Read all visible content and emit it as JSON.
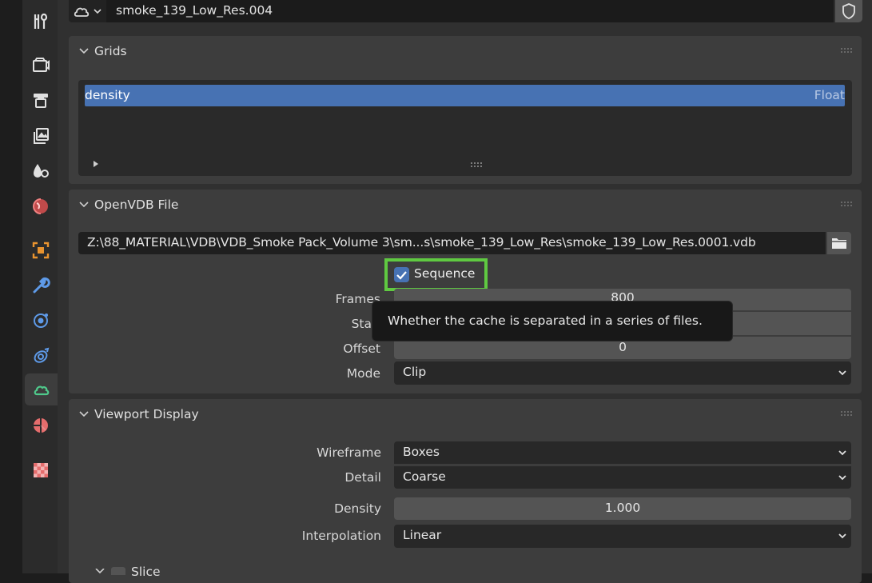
{
  "header": {
    "datablock_name": "smoke_139_Low_Res.004"
  },
  "grids": {
    "title": "Grids",
    "items": [
      {
        "name": "density",
        "type": "Float"
      }
    ]
  },
  "openvdb": {
    "title": "OpenVDB File",
    "filepath": "Z:\\88_MATERIAL\\VDB\\VDB_Smoke Pack_Volume 3\\sm...s\\smoke_139_Low_Res\\smoke_139_Low_Res.0001.vdb",
    "sequence_label": "Sequence",
    "sequence_checked": true,
    "frames_label": "Frames",
    "frames_value": "800",
    "start_label": "Sta",
    "offset_label": "Offset",
    "offset_value": "0",
    "mode_label": "Mode",
    "mode_value": "Clip",
    "tooltip": "Whether the cache is separated in a series of files."
  },
  "viewport": {
    "title": "Viewport Display",
    "wireframe_label": "Wireframe",
    "wireframe_value": "Boxes",
    "detail_label": "Detail",
    "detail_value": "Coarse",
    "density_label": "Density",
    "density_value": "1.000",
    "interpolation_label": "Interpolation",
    "interpolation_value": "Linear",
    "slice_label": "Slice"
  },
  "colors": {
    "highlight_box": "#5fc941",
    "selection": "#4772b3",
    "checkbox": "#4772b3"
  },
  "tab_icons": [
    "tool-icon",
    "render-icon",
    "output-icon",
    "view-layer-icon",
    "scene-icon",
    "world-icon",
    "object-icon",
    "modifier-icon",
    "particles-icon",
    "physics-icon",
    "volume-data-icon",
    "material-icon",
    "texture-icon"
  ]
}
